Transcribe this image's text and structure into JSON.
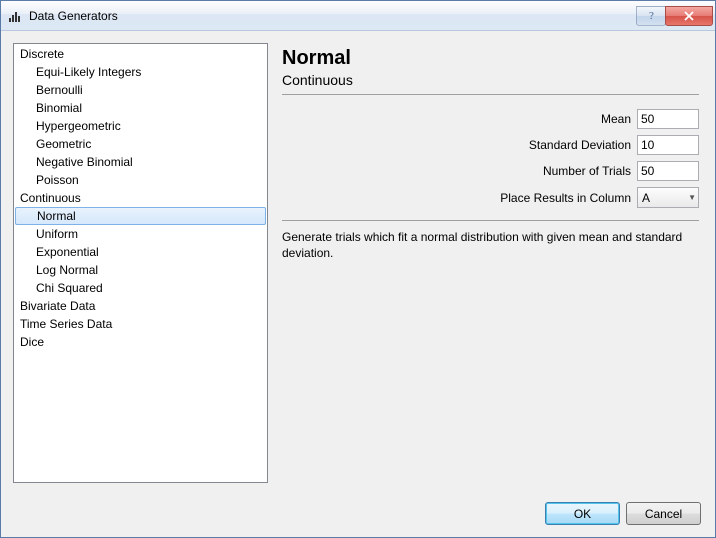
{
  "window": {
    "title": "Data Generators"
  },
  "tree": {
    "categories": [
      {
        "label": "Discrete",
        "items": [
          "Equi-Likely Integers",
          "Bernoulli",
          "Binomial",
          "Hypergeometric",
          "Geometric",
          "Negative Binomial",
          "Poisson"
        ]
      },
      {
        "label": "Continuous",
        "items": [
          "Normal",
          "Uniform",
          "Exponential",
          "Log Normal",
          "Chi Squared"
        ]
      },
      {
        "label": "Bivariate Data",
        "items": []
      },
      {
        "label": "Time Series Data",
        "items": []
      },
      {
        "label": "Dice",
        "items": []
      }
    ],
    "selected": "Normal"
  },
  "panel": {
    "title": "Normal",
    "subtitle": "Continuous",
    "fields": {
      "mean": {
        "label": "Mean",
        "value": "50"
      },
      "stddev": {
        "label": "Standard Deviation",
        "value": "10"
      },
      "trials": {
        "label": "Number of Trials",
        "value": "50"
      },
      "column": {
        "label": "Place Results in Column",
        "value": "A"
      }
    },
    "description": "Generate trials which fit a normal distribution with given mean and standard deviation."
  },
  "buttons": {
    "ok": "OK",
    "cancel": "Cancel"
  }
}
